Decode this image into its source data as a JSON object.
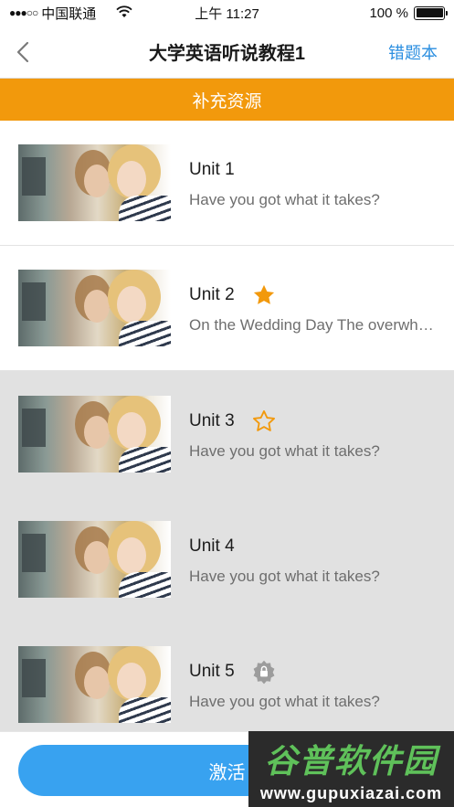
{
  "status_bar": {
    "carrier": "中国联通",
    "time": "上午 11:27",
    "battery_percent": "100 %",
    "battery_level": 1.0
  },
  "nav": {
    "title": "大学英语听说教程1",
    "right_action": "错题本"
  },
  "banner": {
    "label": "补充资源"
  },
  "units": [
    {
      "title": "Unit 1",
      "subtitle": "Have you got what it takes?",
      "icon": "none",
      "locked": false
    },
    {
      "title": "Unit 2",
      "subtitle": "On the Wedding Day The overwhelming",
      "icon": "star-filled-icon",
      "locked": false
    },
    {
      "title": "Unit 3",
      "subtitle": "Have you got what it takes?",
      "icon": "star-outline-icon",
      "locked": true
    },
    {
      "title": "Unit 4",
      "subtitle": "Have you got what it takes?",
      "icon": "none",
      "locked": true
    },
    {
      "title": "Unit 5",
      "subtitle": "Have you got what it takes?",
      "icon": "lock-badge-icon",
      "locked": true
    }
  ],
  "bottom": {
    "button_label": "激活"
  },
  "watermark": {
    "title": "谷普软件园",
    "url": "www.gupuxiazai.com"
  },
  "colors": {
    "accent_orange": "#f2990c",
    "link_blue": "#2a8ee0",
    "button_blue": "#38a2f0",
    "locked_bg": "#e1e1e1"
  }
}
